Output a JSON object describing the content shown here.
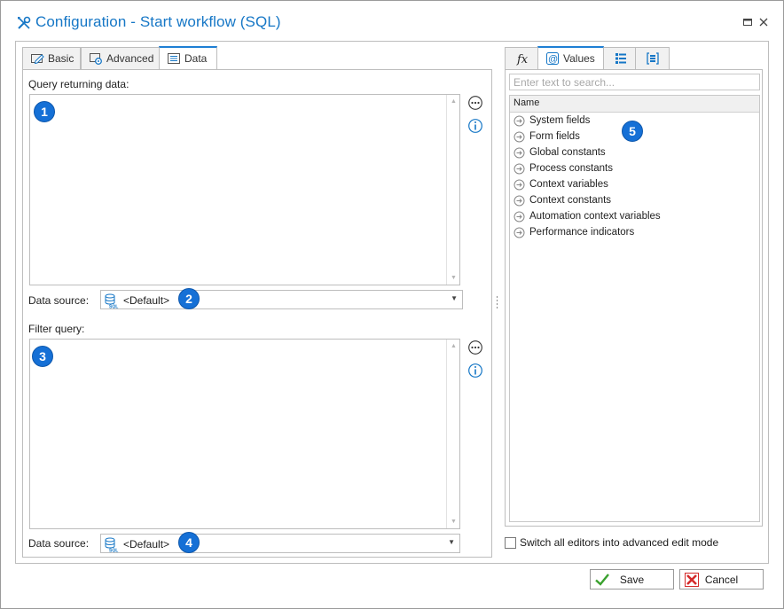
{
  "window": {
    "title": "Configuration - Start workflow (SQL)",
    "icon": "wrench-screwdriver-icon",
    "controls": [
      "maximize-icon",
      "close-icon"
    ]
  },
  "left_tabs": [
    {
      "label": "Basic",
      "icon": "pencil-form-icon",
      "active": false
    },
    {
      "label": "Advanced",
      "icon": "gear-form-icon",
      "active": false
    },
    {
      "label": "Data",
      "icon": "data-list-icon",
      "active": true
    }
  ],
  "data_tab": {
    "query_label": "Query returning data:",
    "query_value": "",
    "query_badge": "1",
    "datasource_label": "Data source:",
    "datasource_value": "<Default>",
    "datasource_badge": "2",
    "filter_label": "Filter query:",
    "filter_value": "",
    "filter_badge": "3",
    "datasource2_label": "Data source:",
    "datasource2_value": "<Default>",
    "datasource2_badge": "4"
  },
  "right_tabs": [
    {
      "label": "",
      "icon": "fx-icon",
      "active": false
    },
    {
      "label": "Values",
      "icon": "at-sign-icon",
      "active": true
    },
    {
      "label": "",
      "icon": "list-icon",
      "active": false
    },
    {
      "label": "",
      "icon": "bracket-list-icon",
      "active": false
    }
  ],
  "values_panel": {
    "search_placeholder": "Enter text to search...",
    "column_header": "Name",
    "badge": "5",
    "items": [
      "System fields",
      "Form fields",
      "Global constants",
      "Process constants",
      "Context variables",
      "Context constants",
      "Automation context variables",
      "Performance indicators"
    ]
  },
  "advanced_mode_label": "Switch all editors into advanced edit mode",
  "advanced_mode_checked": false,
  "buttons": {
    "save": "Save",
    "cancel": "Cancel"
  },
  "colors": {
    "accent": "#1677c6",
    "badge": "#1570d6",
    "save_check": "#3aa12e",
    "cancel_x": "#d42a2a"
  }
}
